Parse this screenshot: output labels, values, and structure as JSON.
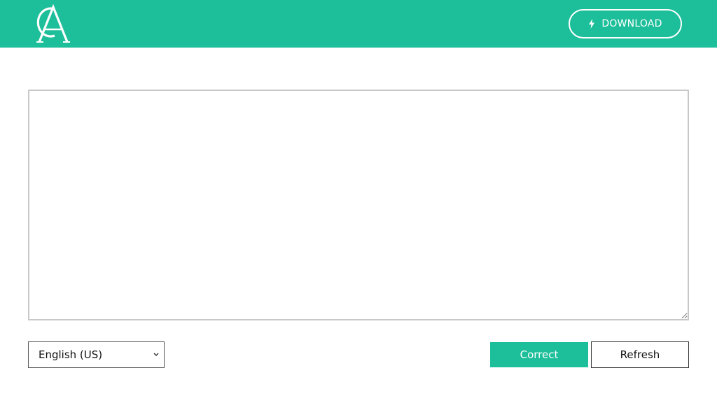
{
  "header": {
    "logo_text": "CA",
    "download_label": "DOWNLOAD",
    "background_color": "#1dbe9a"
  },
  "editor": {
    "value": "",
    "placeholder": ""
  },
  "controls": {
    "language_selected": "English (US)",
    "correct_label": "Correct",
    "refresh_label": "Refresh"
  },
  "icons": {
    "logo": "ca-monogram-icon",
    "download": "lightning-bolt-icon",
    "select": "chevron-down-icon"
  }
}
